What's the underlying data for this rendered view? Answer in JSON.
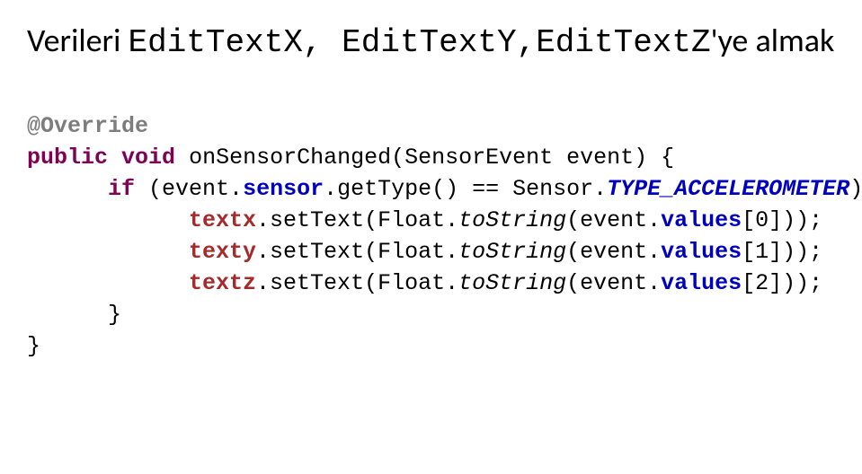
{
  "title": {
    "plain_before": "Verileri ",
    "mono_a": "EditTextX",
    "sep1": ", ",
    "mono_b": "EditTextY",
    "sep2": ",",
    "mono_c": "EditTextZ",
    "plain_after": "'ye almak"
  },
  "code": {
    "override": "@Override",
    "public": "public",
    "void": "void",
    "method": "onSensorChanged(SensorEvent event) {",
    "if": "if",
    "cond_open": " (event.",
    "sensor_field": "sensor",
    "gettype": ".getType() == Sensor.",
    "type_accel": "TYPE_ACCELEROMETER",
    "cond_close": ") {",
    "tx_field": "textx",
    "dot_set": ".setText(Float.",
    "tostring": "toString",
    "ev_open": "(event.",
    "values": "values",
    "idx0": "[0]));",
    "ty_field": "texty",
    "idx1": "[1]));",
    "tz_field": "textz",
    "idx2": "[2]));",
    "brace_close_inner": "}",
    "brace_close_outer": "}"
  }
}
